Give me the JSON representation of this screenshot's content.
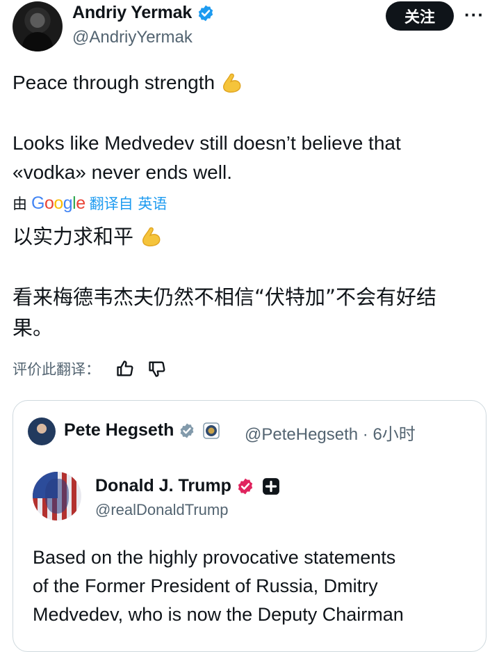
{
  "author": {
    "display_name": "Andriy Yermak",
    "handle": "@AndriyYermak",
    "follow_label": "关注",
    "more_label": "···"
  },
  "tweet": {
    "line1": "Peace through strength",
    "line2": "Looks like Medvedev still doesn’t believe that",
    "line3": "«vodka» never ends well."
  },
  "translation": {
    "prefix": "由",
    "logo": "Google",
    "link": "翻译自 英语",
    "cn_line1": "以实力求和平",
    "cn_line2": "看来梅德韦杰夫仍然不相信“伏特加”不会有好结",
    "cn_line3": "果。",
    "rate_label": "评价此翻译："
  },
  "quote": {
    "name": "Pete Hegseth",
    "handle_time": "@PeteHegseth · 6小时",
    "inner": {
      "name": "Donald J. Trump",
      "handle": "@realDonaldTrump",
      "text_line1": "Based on the highly provocative statements",
      "text_line2": "of the Former President of Russia, Dmitry",
      "text_line3": "Medvedev, who is now the Deputy Chairman"
    }
  },
  "icons": [
    "verified-badge-icon",
    "flexed-biceps-icon",
    "thumbs-up-icon",
    "thumbs-down-icon",
    "government-seal-icon",
    "affiliate-plus-icon"
  ],
  "colors": {
    "verified_blue": "#1d9bf0",
    "secondary_text": "#536471",
    "link_blue": "#1d9bf0",
    "gold_check": "#e0245e"
  }
}
